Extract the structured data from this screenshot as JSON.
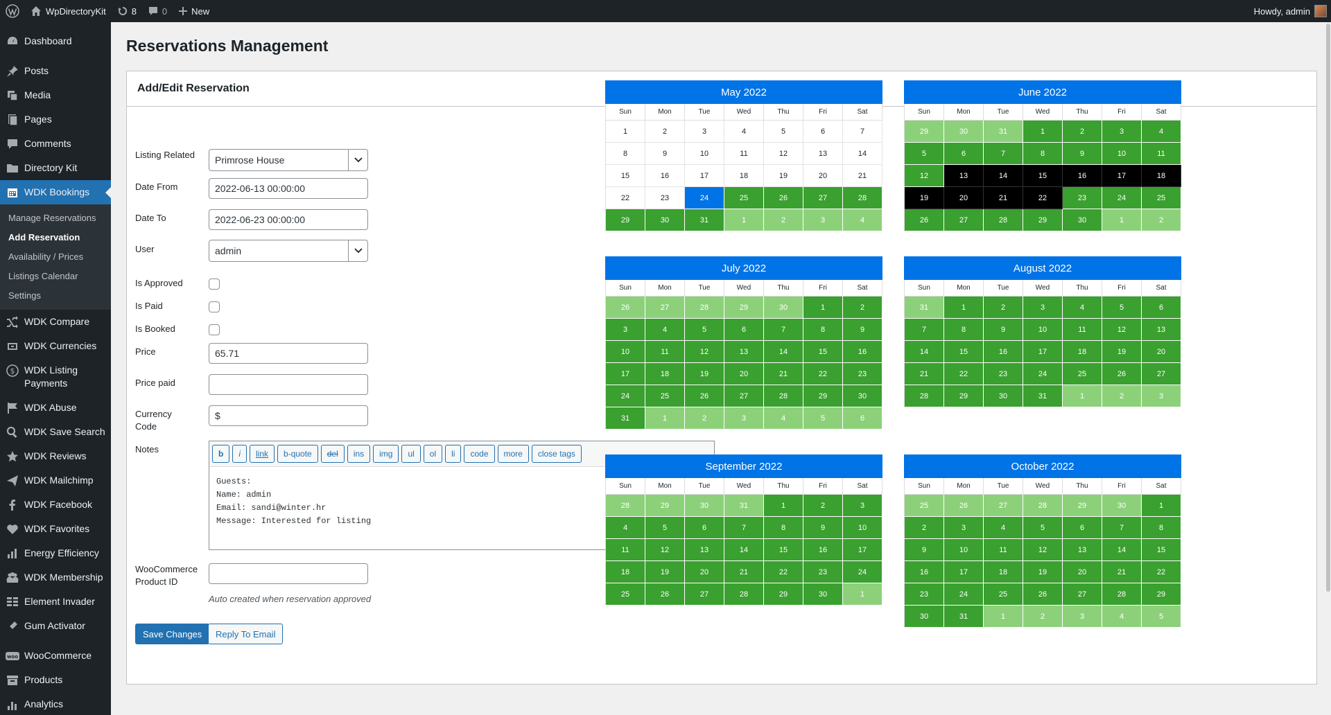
{
  "adminbar": {
    "site_name": "WpDirectoryKit",
    "updates_count": "8",
    "comments_count": "0",
    "new_label": "New",
    "howdy": "Howdy, admin"
  },
  "sidebar": {
    "items": [
      {
        "label": "Dashboard",
        "icon": "dashboard-icon"
      },
      {
        "label": "Posts",
        "icon": "pin-icon"
      },
      {
        "label": "Media",
        "icon": "media-icon"
      },
      {
        "label": "Pages",
        "icon": "pages-icon"
      },
      {
        "label": "Comments",
        "icon": "comments-icon"
      },
      {
        "label": "Directory Kit",
        "icon": "folder-icon"
      },
      {
        "label": "WDK Bookings",
        "icon": "calendar-icon"
      },
      {
        "label": "WDK Compare",
        "icon": "shuffle-icon"
      },
      {
        "label": "WDK Currencies",
        "icon": "currency-icon"
      },
      {
        "label": "WDK Listing Payments",
        "icon": "dollar-icon"
      },
      {
        "label": "WDK Abuse",
        "icon": "flag-icon"
      },
      {
        "label": "WDK Save Search",
        "icon": "search-icon"
      },
      {
        "label": "WDK Reviews",
        "icon": "star-icon"
      },
      {
        "label": "WDK Mailchimp",
        "icon": "send-icon"
      },
      {
        "label": "WDK Facebook",
        "icon": "facebook-icon"
      },
      {
        "label": "WDK Favorites",
        "icon": "heart-icon"
      },
      {
        "label": "Energy Efficiency",
        "icon": "bar-chart-icon"
      },
      {
        "label": "WDK Membership",
        "icon": "membership-icon"
      },
      {
        "label": "Element Invader",
        "icon": "grid-icon"
      },
      {
        "label": "Gum Activator",
        "icon": "activator-icon"
      },
      {
        "label": "WooCommerce",
        "icon": "woo-icon"
      },
      {
        "label": "Products",
        "icon": "archive-icon"
      },
      {
        "label": "Analytics",
        "icon": "analytics-icon"
      }
    ],
    "submenu": [
      "Manage Reservations",
      "Add Reservation",
      "Availability / Prices",
      "Listings Calendar",
      "Settings"
    ]
  },
  "page": {
    "title": "Reservations Management",
    "box_title": "Add/Edit Reservation"
  },
  "form": {
    "listing_label": "Listing Related",
    "listing_value": "Primrose House",
    "date_from_label": "Date From",
    "date_from_value": "2022-06-13 00:00:00",
    "date_to_label": "Date To",
    "date_to_value": "2022-06-23 00:00:00",
    "user_label": "User",
    "user_value": "admin",
    "approved_label": "Is Approved",
    "paid_label": "Is Paid",
    "booked_label": "Is Booked",
    "price_label": "Price",
    "price_value": "65.71",
    "price_paid_label": "Price paid",
    "price_paid_value": "",
    "currency_label": "Currency Code",
    "currency_value": "$",
    "notes_label": "Notes",
    "quicktags": [
      "b",
      "i",
      "link",
      "b-quote",
      "del",
      "ins",
      "img",
      "ul",
      "ol",
      "li",
      "code",
      "more",
      "close tags"
    ],
    "notes_value": "Guests:\nName: admin\nEmail: sandi@winter.hr\nMessage: Interested for listing",
    "woo_label": "WooCommerce Product ID",
    "woo_value": "",
    "woo_hint": "Auto created when reservation approved",
    "save_label": "Save Changes",
    "reply_label": "Reply To Email"
  },
  "calendar": {
    "weekdays": [
      "Sun",
      "Mon",
      "Tue",
      "Wed",
      "Thu",
      "Fri",
      "Sat"
    ],
    "colors": {
      "available": "#3aa02f",
      "other_month": "#8cd17a",
      "booked": "#000000",
      "selected": "#0073e6",
      "header": "#0073e6"
    },
    "months": [
      {
        "title": "May 2022",
        "rows": [
          [
            [
              "1",
              "w"
            ],
            [
              "2",
              "w"
            ],
            [
              "3",
              "w"
            ],
            [
              "4",
              "w"
            ],
            [
              "5",
              "w"
            ],
            [
              "6",
              "w"
            ],
            [
              "7",
              "w"
            ]
          ],
          [
            [
              "8",
              "w"
            ],
            [
              "9",
              "w"
            ],
            [
              "10",
              "w"
            ],
            [
              "11",
              "w"
            ],
            [
              "12",
              "w"
            ],
            [
              "13",
              "w"
            ],
            [
              "14",
              "w"
            ]
          ],
          [
            [
              "15",
              "w"
            ],
            [
              "16",
              "w"
            ],
            [
              "17",
              "w"
            ],
            [
              "18",
              "w"
            ],
            [
              "19",
              "w"
            ],
            [
              "20",
              "w"
            ],
            [
              "21",
              "w"
            ]
          ],
          [
            [
              "22",
              "w"
            ],
            [
              "23",
              "w"
            ],
            [
              "24",
              "sel"
            ],
            [
              "25",
              "g"
            ],
            [
              "26",
              "g"
            ],
            [
              "27",
              "g"
            ],
            [
              "28",
              "g"
            ]
          ],
          [
            [
              "29",
              "g"
            ],
            [
              "30",
              "g"
            ],
            [
              "31",
              "g"
            ],
            [
              "1",
              "lg"
            ],
            [
              "2",
              "lg"
            ],
            [
              "3",
              "lg"
            ],
            [
              "4",
              "lg"
            ]
          ]
        ]
      },
      {
        "title": "June 2022",
        "rows": [
          [
            [
              "29",
              "lg"
            ],
            [
              "30",
              "lg"
            ],
            [
              "31",
              "lg"
            ],
            [
              "1",
              "g"
            ],
            [
              "2",
              "g"
            ],
            [
              "3",
              "g"
            ],
            [
              "4",
              "g"
            ]
          ],
          [
            [
              "5",
              "g"
            ],
            [
              "6",
              "g"
            ],
            [
              "7",
              "g"
            ],
            [
              "8",
              "g"
            ],
            [
              "9",
              "g"
            ],
            [
              "10",
              "g"
            ],
            [
              "11",
              "g"
            ]
          ],
          [
            [
              "12",
              "g"
            ],
            [
              "13",
              "bk"
            ],
            [
              "14",
              "bk"
            ],
            [
              "15",
              "bk"
            ],
            [
              "16",
              "bk"
            ],
            [
              "17",
              "bk"
            ],
            [
              "18",
              "bk"
            ]
          ],
          [
            [
              "19",
              "bk"
            ],
            [
              "20",
              "bk"
            ],
            [
              "21",
              "bk"
            ],
            [
              "22",
              "bk"
            ],
            [
              "23",
              "g"
            ],
            [
              "24",
              "g"
            ],
            [
              "25",
              "g"
            ]
          ],
          [
            [
              "26",
              "g"
            ],
            [
              "27",
              "g"
            ],
            [
              "28",
              "g"
            ],
            [
              "29",
              "g"
            ],
            [
              "30",
              "g"
            ],
            [
              "1",
              "lg"
            ],
            [
              "2",
              "lg"
            ]
          ]
        ]
      },
      {
        "title": "July 2022",
        "rows": [
          [
            [
              "26",
              "lg"
            ],
            [
              "27",
              "lg"
            ],
            [
              "28",
              "lg"
            ],
            [
              "29",
              "lg"
            ],
            [
              "30",
              "lg"
            ],
            [
              "1",
              "g"
            ],
            [
              "2",
              "g"
            ]
          ],
          [
            [
              "3",
              "g"
            ],
            [
              "4",
              "g"
            ],
            [
              "5",
              "g"
            ],
            [
              "6",
              "g"
            ],
            [
              "7",
              "g"
            ],
            [
              "8",
              "g"
            ],
            [
              "9",
              "g"
            ]
          ],
          [
            [
              "10",
              "g"
            ],
            [
              "11",
              "g"
            ],
            [
              "12",
              "g"
            ],
            [
              "13",
              "g"
            ],
            [
              "14",
              "g"
            ],
            [
              "15",
              "g"
            ],
            [
              "16",
              "g"
            ]
          ],
          [
            [
              "17",
              "g"
            ],
            [
              "18",
              "g"
            ],
            [
              "19",
              "g"
            ],
            [
              "20",
              "g"
            ],
            [
              "21",
              "g"
            ],
            [
              "22",
              "g"
            ],
            [
              "23",
              "g"
            ]
          ],
          [
            [
              "24",
              "g"
            ],
            [
              "25",
              "g"
            ],
            [
              "26",
              "g"
            ],
            [
              "27",
              "g"
            ],
            [
              "28",
              "g"
            ],
            [
              "29",
              "g"
            ],
            [
              "30",
              "g"
            ]
          ],
          [
            [
              "31",
              "g"
            ],
            [
              "1",
              "lg"
            ],
            [
              "2",
              "lg"
            ],
            [
              "3",
              "lg"
            ],
            [
              "4",
              "lg"
            ],
            [
              "5",
              "lg"
            ],
            [
              "6",
              "lg"
            ]
          ]
        ]
      },
      {
        "title": "August 2022",
        "rows": [
          [
            [
              "31",
              "lg"
            ],
            [
              "1",
              "g"
            ],
            [
              "2",
              "g"
            ],
            [
              "3",
              "g"
            ],
            [
              "4",
              "g"
            ],
            [
              "5",
              "g"
            ],
            [
              "6",
              "g"
            ]
          ],
          [
            [
              "7",
              "g"
            ],
            [
              "8",
              "g"
            ],
            [
              "9",
              "g"
            ],
            [
              "10",
              "g"
            ],
            [
              "11",
              "g"
            ],
            [
              "12",
              "g"
            ],
            [
              "13",
              "g"
            ]
          ],
          [
            [
              "14",
              "g"
            ],
            [
              "15",
              "g"
            ],
            [
              "16",
              "g"
            ],
            [
              "17",
              "g"
            ],
            [
              "18",
              "g"
            ],
            [
              "19",
              "g"
            ],
            [
              "20",
              "g"
            ]
          ],
          [
            [
              "21",
              "g"
            ],
            [
              "22",
              "g"
            ],
            [
              "23",
              "g"
            ],
            [
              "24",
              "g"
            ],
            [
              "25",
              "g"
            ],
            [
              "26",
              "g"
            ],
            [
              "27",
              "g"
            ]
          ],
          [
            [
              "28",
              "g"
            ],
            [
              "29",
              "g"
            ],
            [
              "30",
              "g"
            ],
            [
              "31",
              "g"
            ],
            [
              "1",
              "lg"
            ],
            [
              "2",
              "lg"
            ],
            [
              "3",
              "lg"
            ]
          ]
        ]
      },
      {
        "title": "September 2022",
        "rows": [
          [
            [
              "28",
              "lg"
            ],
            [
              "29",
              "lg"
            ],
            [
              "30",
              "lg"
            ],
            [
              "31",
              "lg"
            ],
            [
              "1",
              "g"
            ],
            [
              "2",
              "g"
            ],
            [
              "3",
              "g"
            ]
          ],
          [
            [
              "4",
              "g"
            ],
            [
              "5",
              "g"
            ],
            [
              "6",
              "g"
            ],
            [
              "7",
              "g"
            ],
            [
              "8",
              "g"
            ],
            [
              "9",
              "g"
            ],
            [
              "10",
              "g"
            ]
          ],
          [
            [
              "11",
              "g"
            ],
            [
              "12",
              "g"
            ],
            [
              "13",
              "g"
            ],
            [
              "14",
              "g"
            ],
            [
              "15",
              "g"
            ],
            [
              "16",
              "g"
            ],
            [
              "17",
              "g"
            ]
          ],
          [
            [
              "18",
              "g"
            ],
            [
              "19",
              "g"
            ],
            [
              "20",
              "g"
            ],
            [
              "21",
              "g"
            ],
            [
              "22",
              "g"
            ],
            [
              "23",
              "g"
            ],
            [
              "24",
              "g"
            ]
          ],
          [
            [
              "25",
              "g"
            ],
            [
              "26",
              "g"
            ],
            [
              "27",
              "g"
            ],
            [
              "28",
              "g"
            ],
            [
              "29",
              "g"
            ],
            [
              "30",
              "g"
            ],
            [
              "1",
              "lg"
            ]
          ]
        ]
      },
      {
        "title": "October 2022",
        "rows": [
          [
            [
              "25",
              "lg"
            ],
            [
              "26",
              "lg"
            ],
            [
              "27",
              "lg"
            ],
            [
              "28",
              "lg"
            ],
            [
              "29",
              "lg"
            ],
            [
              "30",
              "lg"
            ],
            [
              "1",
              "g"
            ]
          ],
          [
            [
              "2",
              "g"
            ],
            [
              "3",
              "g"
            ],
            [
              "4",
              "g"
            ],
            [
              "5",
              "g"
            ],
            [
              "6",
              "g"
            ],
            [
              "7",
              "g"
            ],
            [
              "8",
              "g"
            ]
          ],
          [
            [
              "9",
              "g"
            ],
            [
              "10",
              "g"
            ],
            [
              "11",
              "g"
            ],
            [
              "12",
              "g"
            ],
            [
              "13",
              "g"
            ],
            [
              "14",
              "g"
            ],
            [
              "15",
              "g"
            ]
          ],
          [
            [
              "16",
              "g"
            ],
            [
              "17",
              "g"
            ],
            [
              "18",
              "g"
            ],
            [
              "19",
              "g"
            ],
            [
              "20",
              "g"
            ],
            [
              "21",
              "g"
            ],
            [
              "22",
              "g"
            ]
          ],
          [
            [
              "23",
              "g"
            ],
            [
              "24",
              "g"
            ],
            [
              "25",
              "g"
            ],
            [
              "26",
              "g"
            ],
            [
              "27",
              "g"
            ],
            [
              "28",
              "g"
            ],
            [
              "29",
              "g"
            ]
          ],
          [
            [
              "30",
              "g"
            ],
            [
              "31",
              "g"
            ],
            [
              "1",
              "lg"
            ],
            [
              "2",
              "lg"
            ],
            [
              "3",
              "lg"
            ],
            [
              "4",
              "lg"
            ],
            [
              "5",
              "lg"
            ]
          ]
        ]
      }
    ]
  }
}
